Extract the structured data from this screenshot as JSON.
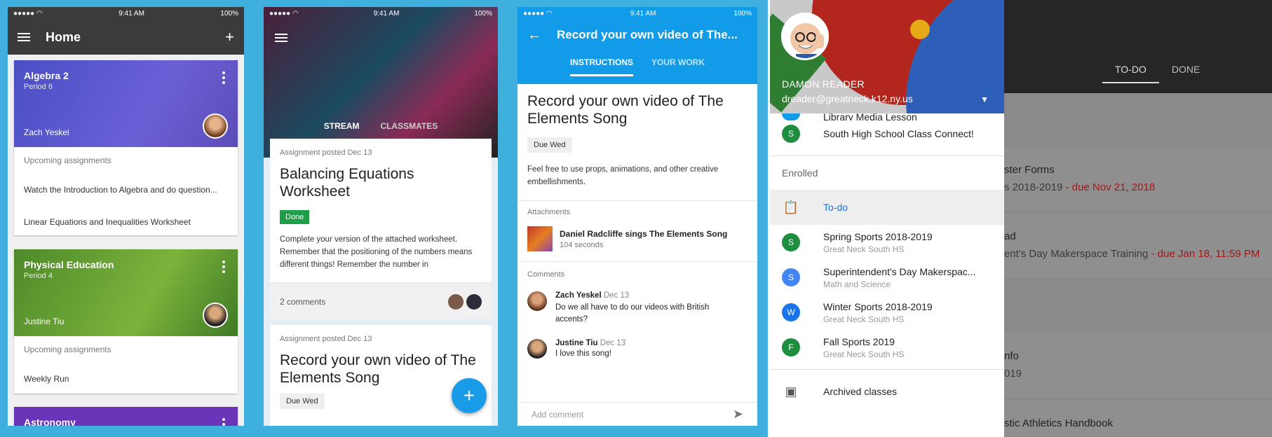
{
  "status": {
    "carrier": "●●●●● ◠",
    "time": "9:41 AM",
    "battery": "100%"
  },
  "home": {
    "title": "Home",
    "classes": [
      {
        "name": "Algebra 2",
        "period": "Period 6",
        "teacher": "Zach Yeskel",
        "upcoming_label": "Upcoming assignments",
        "items": [
          "Watch the Introduction to Algebra and do question...",
          "Linear Equations and Inequalities Worksheet"
        ]
      },
      {
        "name": "Physical Education",
        "period": "Period 4",
        "teacher": "Justine Tiu",
        "upcoming_label": "Upcoming assignments",
        "items": [
          "Weekly Run"
        ]
      },
      {
        "name": "Astronomy"
      }
    ]
  },
  "stream": {
    "tabs": [
      "STREAM",
      "CLASSMATES"
    ],
    "posts": [
      {
        "posted": "Assignment posted Dec 13",
        "title": "Balancing Equations Worksheet",
        "status": "Done",
        "desc": "Complete your version of the attached worksheet. Remember that the positioning of the numbers means different things! Remember the number in",
        "comments": "2 comments"
      },
      {
        "posted": "Assignment posted Dec 13",
        "title": "Record your own video of The Elements Song",
        "due": "Due Wed"
      }
    ],
    "fab": "+"
  },
  "detail": {
    "title": "Record your own video of The...",
    "tabs": [
      "INSTRUCTIONS",
      "YOUR WORK"
    ],
    "heading": "Record your own video of The Elements Song",
    "due": "Due Wed",
    "desc": "Feel free to use props, animations, and other creative embellishments.",
    "attachments_label": "Attachments",
    "attachment": {
      "title": "Daniel Radcliffe sings The Elements Song",
      "meta": "104 seconds"
    },
    "comments_label": "Comments",
    "comments": [
      {
        "name": "Zach Yeskel",
        "date": "Dec 13",
        "text": "Do we all have to do our videos with British accents?"
      },
      {
        "name": "Justine Tiu",
        "date": "Dec 13",
        "text": "I love this song!"
      }
    ],
    "add_comment": "Add comment"
  },
  "drawer": {
    "user_name": "DAMON READER",
    "email": "dreader@greatneck.k12.ny.us",
    "partial_item": "Library Media Lesson",
    "top_item": {
      "initial": "S",
      "label": "South High School Class Connect!"
    },
    "enrolled_label": "Enrolled",
    "todo_label": "To-do",
    "classes": [
      {
        "initial": "S",
        "label": "Spring Sports 2018-2019",
        "sub": "Great Neck South HS",
        "color": "#1e8e3e"
      },
      {
        "initial": "S",
        "label": "Superintendent's Day Makerspac...",
        "sub": "Math and Science",
        "color": "#4285f4"
      },
      {
        "initial": "W",
        "label": "Winter Sports 2018-2019",
        "sub": "Great Neck South HS",
        "color": "#1a73e8"
      },
      {
        "initial": "F",
        "label": "Fall Sports 2019",
        "sub": "Great Neck South HS",
        "color": "#1e8e3e"
      }
    ],
    "archived_label": "Archived classes"
  },
  "background": {
    "tabs": [
      "TO-DO",
      "DONE"
    ],
    "rows": [
      {
        "title": "ster Forms",
        "prefix": "s 2018-2019",
        "due": " - due Nov 21, 2018"
      },
      {
        "title": "ad",
        "prefix": "ent's Day Makerspace Training",
        "due": " - due Jan 18, 11:59 PM"
      },
      {
        "title": "nfo",
        "prefix": "019"
      },
      {
        "title": "stic Athletics Handbook"
      }
    ]
  }
}
